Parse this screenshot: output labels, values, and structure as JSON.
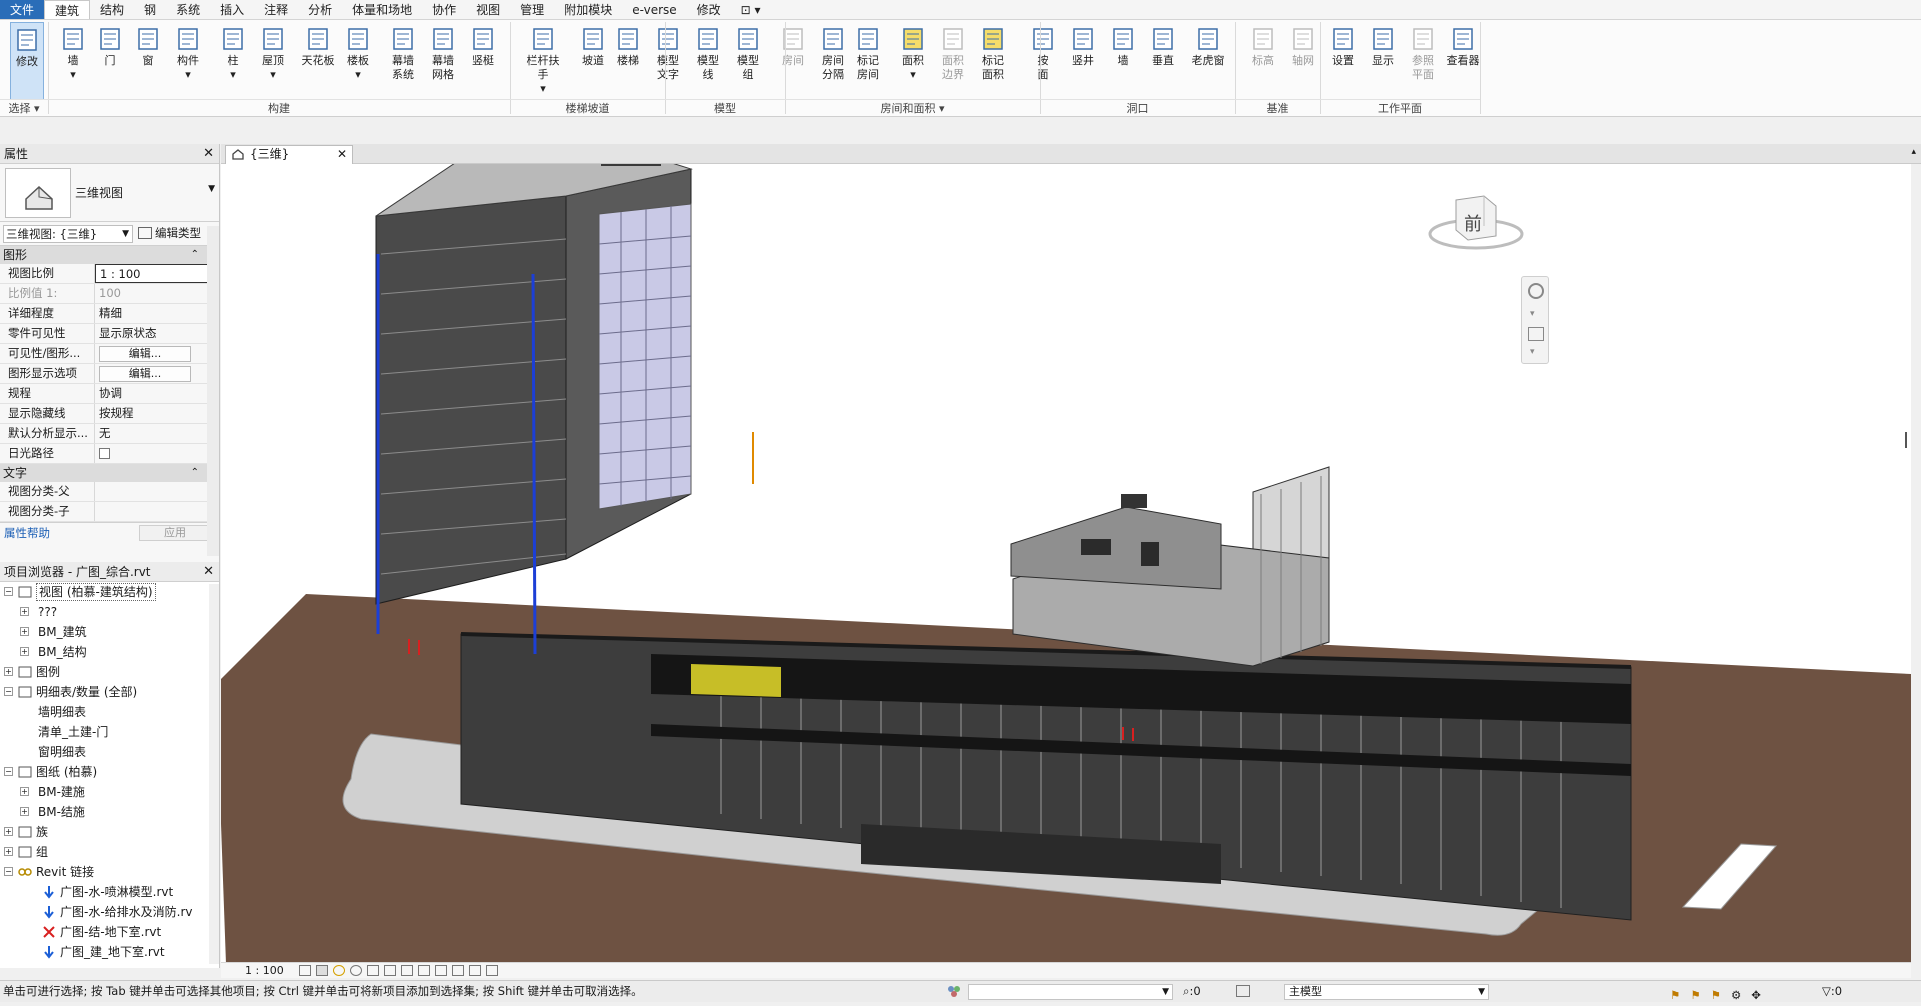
{
  "menu": {
    "tabs": [
      "文件",
      "建筑",
      "结构",
      "钢",
      "系统",
      "插入",
      "注释",
      "分析",
      "体量和场地",
      "协作",
      "视图",
      "管理",
      "附加模块",
      "e-verse",
      "修改",
      "⊡ ▾"
    ]
  },
  "ribbon": {
    "buttons": [
      {
        "id": "modify",
        "l1": "修改",
        "l2": ""
      },
      {
        "id": "wall",
        "l1": "墙",
        "l2": "▾"
      },
      {
        "id": "door",
        "l1": "门",
        "l2": ""
      },
      {
        "id": "window",
        "l1": "窗",
        "l2": ""
      },
      {
        "id": "component",
        "l1": "构件",
        "l2": "▾"
      },
      {
        "id": "column",
        "l1": "柱",
        "l2": "▾"
      },
      {
        "id": "roof",
        "l1": "屋顶",
        "l2": "▾"
      },
      {
        "id": "ceiling",
        "l1": "天花板",
        "l2": ""
      },
      {
        "id": "floor",
        "l1": "楼板",
        "l2": "▾"
      },
      {
        "id": "curtain-system",
        "l1": "幕墙",
        "l2": "系统"
      },
      {
        "id": "curtain-grid",
        "l1": "幕墙",
        "l2": "网格"
      },
      {
        "id": "mullion",
        "l1": "竖梃",
        "l2": ""
      },
      {
        "id": "railing",
        "l1": "栏杆扶手",
        "l2": "▾"
      },
      {
        "id": "ramp",
        "l1": "坡道",
        "l2": ""
      },
      {
        "id": "stair",
        "l1": "楼梯",
        "l2": ""
      },
      {
        "id": "model-text",
        "l1": "模型",
        "l2": "文字"
      },
      {
        "id": "model-line",
        "l1": "模型",
        "l2": "线"
      },
      {
        "id": "model-group",
        "l1": "模型",
        "l2": "组"
      },
      {
        "id": "room",
        "l1": "房间",
        "l2": ""
      },
      {
        "id": "room-separator",
        "l1": "房间",
        "l2": "分隔"
      },
      {
        "id": "tag-room",
        "l1": "标记",
        "l2": "房间"
      },
      {
        "id": "area",
        "l1": "面积",
        "l2": "▾"
      },
      {
        "id": "area-boundary",
        "l1": "面积",
        "l2": "边界"
      },
      {
        "id": "tag-area",
        "l1": "标记",
        "l2": "面积"
      },
      {
        "id": "by-face",
        "l1": "按",
        "l2": "面"
      },
      {
        "id": "shaft",
        "l1": "竖井",
        "l2": ""
      },
      {
        "id": "wall-opening",
        "l1": "墙",
        "l2": ""
      },
      {
        "id": "vertical",
        "l1": "垂直",
        "l2": ""
      },
      {
        "id": "dormer",
        "l1": "老虎窗",
        "l2": ""
      },
      {
        "id": "level",
        "l1": "标高",
        "l2": ""
      },
      {
        "id": "grid",
        "l1": "轴网",
        "l2": ""
      },
      {
        "id": "set",
        "l1": "设置",
        "l2": ""
      },
      {
        "id": "show",
        "l1": "显示",
        "l2": ""
      },
      {
        "id": "ref-plane",
        "l1": "参照",
        "l2": "平面"
      },
      {
        "id": "viewer",
        "l1": "查看器",
        "l2": ""
      }
    ],
    "groups": [
      "选择 ▾",
      "构建",
      "楼梯坡道",
      "模型",
      "房间和面积 ▾",
      "洞口",
      "基准",
      "工作平面"
    ]
  },
  "properties": {
    "title": "属性",
    "type_name": "三维视图",
    "selector": "三维视图: {三维}",
    "edit_type": "编辑类型",
    "section_graphics": "图形",
    "rows": [
      {
        "k": "视图比例",
        "v": "1 : 100"
      },
      {
        "k": "比例值 1:",
        "v": "100"
      },
      {
        "k": "详细程度",
        "v": "精细"
      },
      {
        "k": "零件可见性",
        "v": "显示原状态"
      },
      {
        "k": "可见性/图形...",
        "v": "编辑..."
      },
      {
        "k": "图形显示选项",
        "v": "编辑..."
      },
      {
        "k": "规程",
        "v": "协调"
      },
      {
        "k": "显示隐藏线",
        "v": "按规程"
      },
      {
        "k": "默认分析显示...",
        "v": "无"
      },
      {
        "k": "日光路径",
        "v": ""
      }
    ],
    "section_text": "文字",
    "text_rows": [
      {
        "k": "视图分类-父",
        "v": ""
      },
      {
        "k": "视图分类-子",
        "v": ""
      }
    ],
    "help": "属性帮助",
    "apply": "应用"
  },
  "browser": {
    "title": "项目浏览器 - 广图_综合.rvt",
    "nodes": [
      {
        "t": "视图 (柏慕-建筑结构)",
        "level": 0,
        "exp": "−"
      },
      {
        "t": "???",
        "level": 1,
        "exp": "+"
      },
      {
        "t": "BM_建筑",
        "level": 1,
        "exp": "+"
      },
      {
        "t": "BM_结构",
        "level": 1,
        "exp": "+"
      },
      {
        "t": "图例",
        "level": 0,
        "exp": "+"
      },
      {
        "t": "明细表/数量 (全部)",
        "level": 0,
        "exp": "−"
      },
      {
        "t": "墙明细表",
        "level": 1,
        "exp": ""
      },
      {
        "t": "清单_土建-门",
        "level": 1,
        "exp": ""
      },
      {
        "t": "窗明细表",
        "level": 1,
        "exp": ""
      },
      {
        "t": "图纸 (柏慕)",
        "level": 0,
        "exp": "−"
      },
      {
        "t": "BM-建施",
        "level": 1,
        "exp": "+"
      },
      {
        "t": "BM-结施",
        "level": 1,
        "exp": "+"
      },
      {
        "t": "族",
        "level": 0,
        "exp": "+"
      },
      {
        "t": "组",
        "level": 0,
        "exp": "+"
      },
      {
        "t": "Revit 链接",
        "level": 0,
        "exp": "−"
      },
      {
        "t": "广图-水-喷淋模型.rvt",
        "level": 2,
        "exp": ""
      },
      {
        "t": "广图-水-给排水及消防.rv",
        "level": 2,
        "exp": ""
      },
      {
        "t": "广图-结-地下室.rvt",
        "level": 2,
        "exp": ""
      },
      {
        "t": "广图_建_地下室.rvt",
        "level": 2,
        "exp": ""
      }
    ]
  },
  "view": {
    "tab": "{三维}",
    "viewcube": "前",
    "scale": "1 : 100"
  },
  "status": {
    "hint": "单击可进行选择; 按 Tab 键并单击可选择其他项目; 按 Ctrl 键并单击可将新项目添加到选择集; 按 Shift 键并单击可取消选择。",
    "worksets": ":0",
    "model": "主模型",
    "filter": ":0"
  },
  "colors": {
    "ground": "#6e5242",
    "building": "#3f3f3f",
    "glass": "#c9c9e6",
    "accent_blue": "#1c3fd6",
    "accent_yellow": "#e6dc2a",
    "accent_red": "#d82020"
  }
}
